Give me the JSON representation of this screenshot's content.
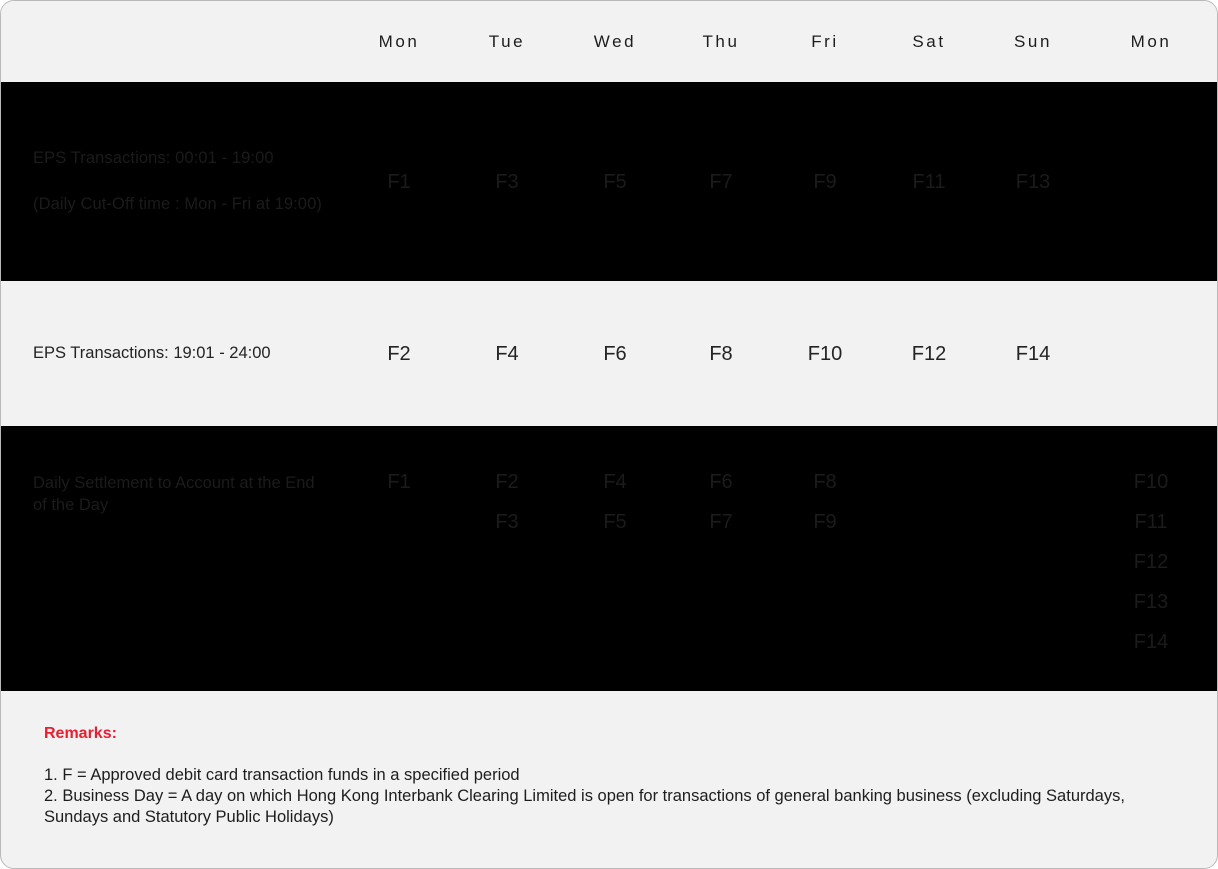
{
  "table": {
    "columns": [
      "",
      "Mon",
      "Tue",
      "Wed",
      "Thu",
      "Fri",
      "Sat",
      "Sun",
      "Mon"
    ],
    "rows": [
      {
        "theme": "dark",
        "label_line_1": "EPS Transactions:  00:01 - 19:00",
        "label_line_2": "(Daily Cut-Off time : Mon - Fri at 19:00)",
        "cells": [
          [
            "F1"
          ],
          [
            "F3"
          ],
          [
            "F5"
          ],
          [
            "F7"
          ],
          [
            "F9"
          ],
          [
            "F11"
          ],
          [
            "F13"
          ],
          []
        ]
      },
      {
        "theme": "light",
        "label_line_1": "EPS Transactions: 19:01 - 24:00",
        "label_line_2": "",
        "cells": [
          [
            "F2"
          ],
          [
            "F4"
          ],
          [
            "F6"
          ],
          [
            "F8"
          ],
          [
            "F10"
          ],
          [
            "F12"
          ],
          [
            "F14"
          ],
          []
        ]
      },
      {
        "theme": "dark",
        "label_line_1": "Daily Settlement to Account at the End of the Day",
        "label_line_2": "",
        "cells": [
          [
            "F1"
          ],
          [
            "F2",
            "F3"
          ],
          [
            "F4",
            "F5"
          ],
          [
            "F6",
            "F7"
          ],
          [
            "F8",
            "F9"
          ],
          [],
          [],
          [
            "F10",
            "F11",
            "F12",
            "F13",
            "F14"
          ]
        ]
      }
    ]
  },
  "remarks": {
    "title": "Remarks:",
    "note_1": "1. F = Approved debit card transaction funds in a specified period",
    "note_2": "2. Business Day = A day on which Hong Kong Interbank Clearing Limited is open for transactions of general banking business (excluding Saturdays, Sundays and Statutory Public Holidays)"
  },
  "colors": {
    "dark_row_background": "#000000",
    "dark_row_text": "#1b1b1b",
    "light_row_background": "#f2f2f2",
    "light_row_text": "#232323",
    "remarks_accent": "#ee1c2e",
    "card_border": "#b9b9b9"
  }
}
